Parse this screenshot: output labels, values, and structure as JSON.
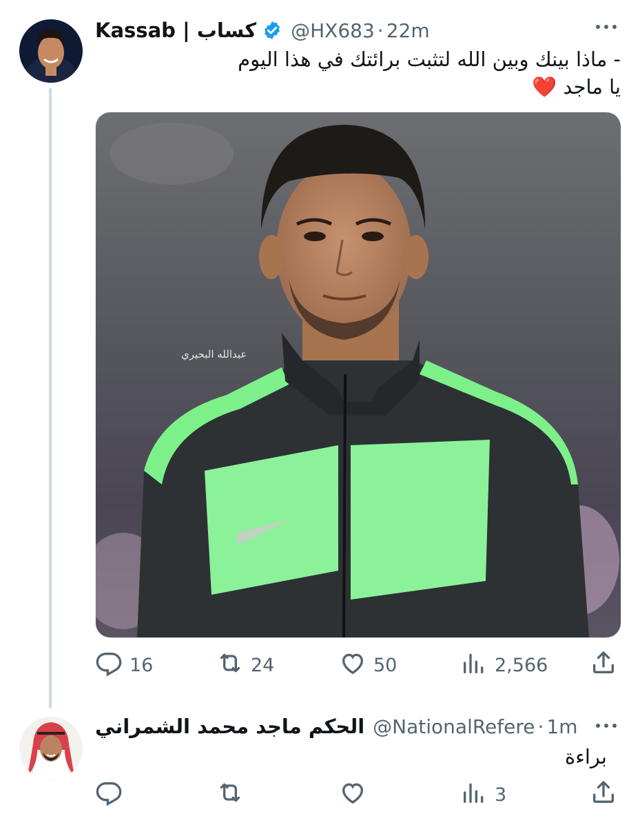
{
  "tweet1": {
    "display_name": "Kassab | كساب",
    "handle": "@HX683",
    "separator": "·",
    "time": "22m",
    "text_line1": "- ماذا بينك وبين الله لتثبت برائتك في هذا اليوم",
    "text_line2": "يا ماجد ❤️",
    "media_watermark": "عبدالله البحيري",
    "replies": "16",
    "retweets": "24",
    "likes": "50",
    "views": "2,566"
  },
  "tweet2": {
    "display_name": "الحكم ماجد محمد الشمراني",
    "handle": "@NationalRefere",
    "separator": "·",
    "time": "1m",
    "text": "براءة",
    "replies": "",
    "retweets": "",
    "likes": "",
    "views": "3"
  },
  "colors": {
    "text_primary": "#0f1419",
    "text_secondary": "#536471",
    "verified_badge": "#1d9bf0",
    "thread_line": "#cfd9de",
    "jacket_green": "#7ef08a",
    "jacket_dark": "#2d3134"
  },
  "icons": [
    "reply-icon",
    "retweet-icon",
    "like-icon",
    "views-icon",
    "share-icon",
    "more-icon",
    "verified-badge-icon"
  ]
}
